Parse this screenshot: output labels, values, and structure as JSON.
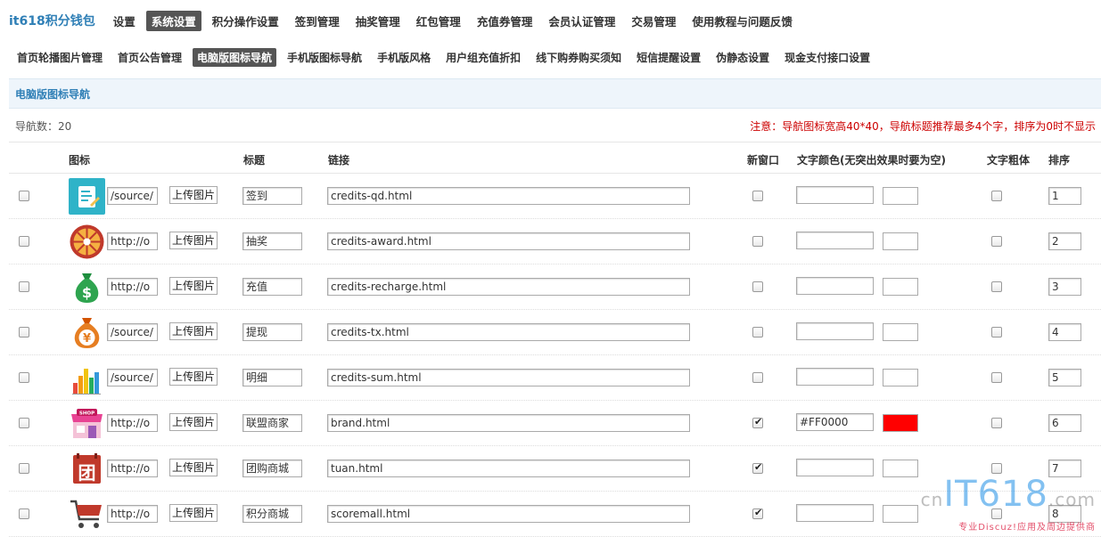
{
  "brand": "it618积分钱包",
  "top_nav": [
    "设置",
    "系统设置",
    "积分操作设置",
    "签到管理",
    "抽奖管理",
    "红包管理",
    "充值券管理",
    "会员认证管理",
    "交易管理",
    "使用教程与问题反馈"
  ],
  "top_nav_active": 1,
  "sub_nav": [
    "首页轮播图片管理",
    "首页公告管理",
    "电脑版图标导航",
    "手机版图标导航",
    "手机版风格",
    "用户组充值折扣",
    "线下购券购买须知",
    "短信提醒设置",
    "伪静态设置",
    "现金支付接口设置"
  ],
  "sub_nav_active": 2,
  "section_title": "电脑版图标导航",
  "nav_count": "导航数：20",
  "notice": "注意：导航图标宽高40*40，导航标题推荐最多4个字，排序为0时不显示",
  "headers": {
    "icon": "图标",
    "title": "标题",
    "link": "链接",
    "new_window": "新窗口",
    "text_color": "文字颜色(无突出效果时要为空)",
    "bold": "文字粗体",
    "order": "排序"
  },
  "upload_label": "上传图片",
  "rows": [
    {
      "icon": "sign-in-icon",
      "path": "/source/",
      "title": "签到",
      "link": "credits-qd.html",
      "new_window": false,
      "color": "",
      "color_hex": "#ffffff",
      "order": "1"
    },
    {
      "icon": "lottery-wheel-icon",
      "path": "http://o",
      "title": "抽奖",
      "link": "credits-award.html",
      "new_window": false,
      "color": "",
      "color_hex": "#ffffff",
      "order": "2"
    },
    {
      "icon": "money-bag-dollar-icon",
      "path": "http://o",
      "title": "充值",
      "link": "credits-recharge.html",
      "new_window": false,
      "color": "",
      "color_hex": "#ffffff",
      "order": "3"
    },
    {
      "icon": "money-bag-yen-icon",
      "path": "/source/",
      "title": "提现",
      "link": "credits-tx.html",
      "new_window": false,
      "color": "",
      "color_hex": "#ffffff",
      "order": "4"
    },
    {
      "icon": "bar-chart-icon",
      "path": "/source/",
      "title": "明细",
      "link": "credits-sum.html",
      "new_window": false,
      "color": "",
      "color_hex": "#ffffff",
      "order": "5"
    },
    {
      "icon": "shop-icon",
      "path": "http://o",
      "title": "联盟商家",
      "link": "brand.html",
      "new_window": true,
      "color": "#FF0000",
      "color_hex": "#ff0000",
      "order": "6"
    },
    {
      "icon": "group-buy-icon",
      "path": "http://o",
      "title": "团购商城",
      "link": "tuan.html",
      "new_window": true,
      "color": "",
      "color_hex": "#ffffff",
      "order": "7"
    },
    {
      "icon": "shopping-cart-icon",
      "path": "http://o",
      "title": "积分商城",
      "link": "scoremall.html",
      "new_window": true,
      "color": "",
      "color_hex": "#ffffff",
      "order": "8"
    }
  ],
  "watermark": {
    "prefix": "cn",
    "main": "IT618",
    "suffix": ".com",
    "tagline": "专业Discuz!应用及周边提供商"
  },
  "colors": {
    "accent": "#2f7fb6",
    "notice": "#cc0000",
    "active_tab": "#555555"
  }
}
